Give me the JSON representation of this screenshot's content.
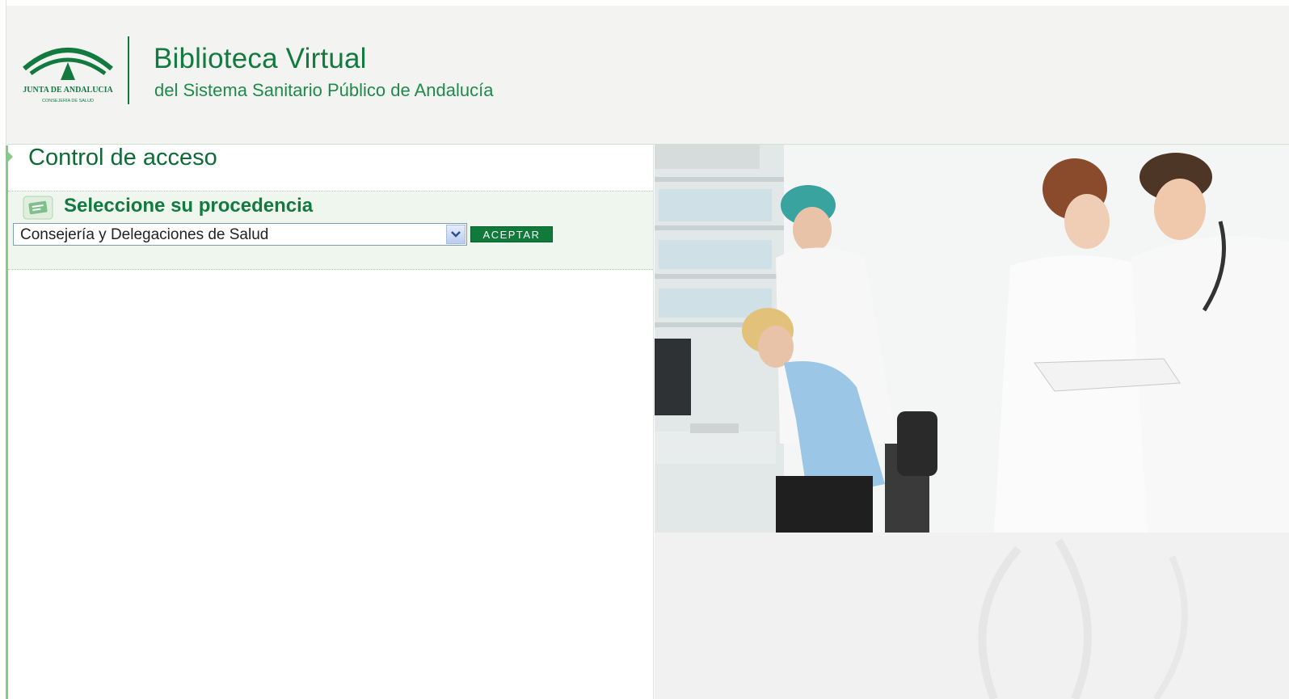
{
  "header": {
    "logo_text": "JUNTA DE ANDALUCIA",
    "logo_subtext": "CONSEJERÍA DE SALUD",
    "title": "Biblioteca Virtual",
    "subtitle": "del Sistema Sanitario Público de Andalucía"
  },
  "main": {
    "section_title": "Control de acceso",
    "procedencia": {
      "title": "Seleccione su procedencia",
      "selected": "Consejería y Delegaciones de Salud",
      "accept_label": "ACEPTAR"
    }
  },
  "icons": {
    "section": "arrow-right-icon",
    "procedencia": "id-card-icon",
    "select": "chevron-down-icon"
  },
  "colors": {
    "brand_green": "#127a3f",
    "accent_green": "#86c98a",
    "header_bg": "#f3f4f2"
  }
}
